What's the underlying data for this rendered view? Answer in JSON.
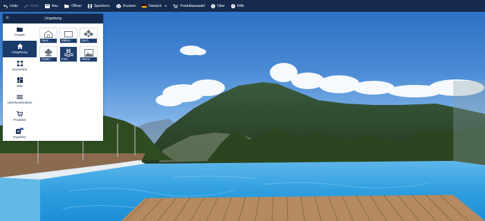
{
  "toolbar": {
    "items": [
      {
        "label": "Undo",
        "icon": "undo-icon",
        "enabled": true
      },
      {
        "label": "Redo",
        "icon": "redo-icon",
        "enabled": false
      },
      {
        "label": "Neu",
        "icon": "new-file-icon",
        "enabled": true
      },
      {
        "label": "Öffnen",
        "icon": "folder-open-icon",
        "enabled": true
      },
      {
        "label": "Speichern",
        "icon": "save-icon",
        "enabled": true
      },
      {
        "label": "Drucken",
        "icon": "print-icon",
        "enabled": true
      },
      {
        "label": "Deutsch",
        "icon": "german-flag-icon",
        "enabled": true
      },
      {
        "label": "Produktauswahl",
        "icon": "cart-icon",
        "enabled": true
      },
      {
        "label": "Über",
        "icon": "info-icon",
        "enabled": true
      },
      {
        "label": "Hilfe",
        "icon": "help-icon",
        "enabled": true
      }
    ]
  },
  "panel": {
    "collapse_label": "⇇",
    "title": "Umgebung",
    "nav": [
      {
        "label": "Projekt",
        "icon": "folder-icon",
        "active": false
      },
      {
        "label": "Umgebung",
        "icon": "home-icon",
        "active": true
      },
      {
        "label": "Geometrie",
        "icon": "geometry-icon",
        "active": false
      },
      {
        "label": "Stile",
        "icon": "layout-icon",
        "active": false
      },
      {
        "label": "Unterkonstruktion",
        "icon": "layers-icon",
        "active": false
      },
      {
        "label": "Produkte",
        "icon": "cart-icon",
        "active": false
      },
      {
        "label": "Ergebnis",
        "icon": "result-icon",
        "active": false
      }
    ],
    "tiles": [
      {
        "label": "Haus",
        "icon": "house-icon",
        "active": false
      },
      {
        "label": "Balkon",
        "icon": "balcony-icon",
        "active": false
      },
      {
        "label": "Dach",
        "icon": "roof-icon",
        "active": false
      },
      {
        "label": "Garten",
        "icon": "garden-icon",
        "active": false
      },
      {
        "label": "Pool",
        "icon": "pool-icon",
        "active": true
      },
      {
        "label": "Nutzer",
        "icon": "image-icon",
        "active": false
      }
    ]
  },
  "colors": {
    "toolbar_bg": "#152a4d",
    "accent": "#1d3e6e",
    "disabled": "#6d7d99"
  }
}
